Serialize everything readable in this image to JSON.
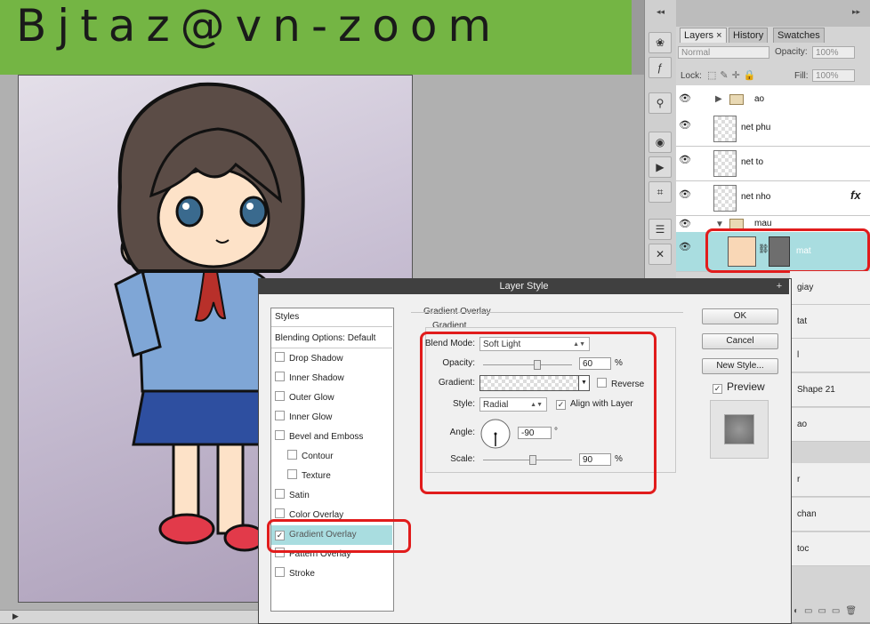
{
  "watermark": "Bjtaz@vn-zoom",
  "panel": {
    "tabs": [
      {
        "label": "Layers"
      },
      {
        "label": "History"
      },
      {
        "label": "Swatches"
      }
    ],
    "blend_mode": "Normal",
    "opacity_label": "Opacity:",
    "opacity_value": "100%",
    "lock_label": "Lock:",
    "fill_label": "Fill:",
    "fill_value": "100%"
  },
  "layers": [
    {
      "name": "ao",
      "type": "group",
      "expanded": false
    },
    {
      "name": "net phu",
      "type": "layer"
    },
    {
      "name": "net to",
      "type": "layer"
    },
    {
      "name": "net nho",
      "type": "layer",
      "fx": "fx"
    },
    {
      "name": "mau",
      "type": "group",
      "expanded": true
    },
    {
      "name": "mat",
      "type": "layer",
      "selected": true
    }
  ],
  "layers_right": [
    "giay",
    "tat",
    "l",
    "Shape 21",
    "ao",
    "r",
    "chan",
    "toc"
  ],
  "dialog": {
    "title": "Layer Style",
    "close": "+",
    "styles_header": "Styles",
    "blending_options": "Blending Options: Default",
    "styles": [
      {
        "label": "Drop Shadow",
        "checked": false,
        "indent": false
      },
      {
        "label": "Inner Shadow",
        "checked": false,
        "indent": false
      },
      {
        "label": "Outer Glow",
        "checked": false,
        "indent": false
      },
      {
        "label": "Inner Glow",
        "checked": false,
        "indent": false
      },
      {
        "label": "Bevel and Emboss",
        "checked": false,
        "indent": false
      },
      {
        "label": "Contour",
        "checked": false,
        "indent": true
      },
      {
        "label": "Texture",
        "checked": false,
        "indent": true
      },
      {
        "label": "Satin",
        "checked": false,
        "indent": false
      },
      {
        "label": "Color Overlay",
        "checked": false,
        "indent": false
      },
      {
        "label": "Gradient Overlay",
        "checked": true,
        "indent": false,
        "selected": true
      },
      {
        "label": "Pattern Overlay",
        "checked": false,
        "indent": false
      },
      {
        "label": "Stroke",
        "checked": false,
        "indent": false
      }
    ],
    "section_title": "Gradient Overlay",
    "group_title": "Gradient",
    "blend_mode_label": "Blend Mode:",
    "blend_mode_value": "Soft Light",
    "opacity_label": "Opacity:",
    "opacity_value": "60",
    "opacity_unit": "%",
    "opacity_fraction": 0.6,
    "gradient_label": "Gradient:",
    "reverse_label": "Reverse",
    "reverse_checked": false,
    "style_label": "Style:",
    "style_value": "Radial",
    "align_label": "Align with Layer",
    "align_checked": true,
    "angle_label": "Angle:",
    "angle_value": "-90",
    "angle_unit": "°",
    "scale_label": "Scale:",
    "scale_value": "90",
    "scale_unit": "%",
    "scale_fraction": 0.55,
    "ok": "OK",
    "cancel": "Cancel",
    "new_style": "New Style...",
    "preview_label": "Preview",
    "preview_checked": true
  },
  "colors": {
    "banner": "#74b544",
    "highlight": "#e11c1c",
    "selected_row": "#a9dde0"
  }
}
